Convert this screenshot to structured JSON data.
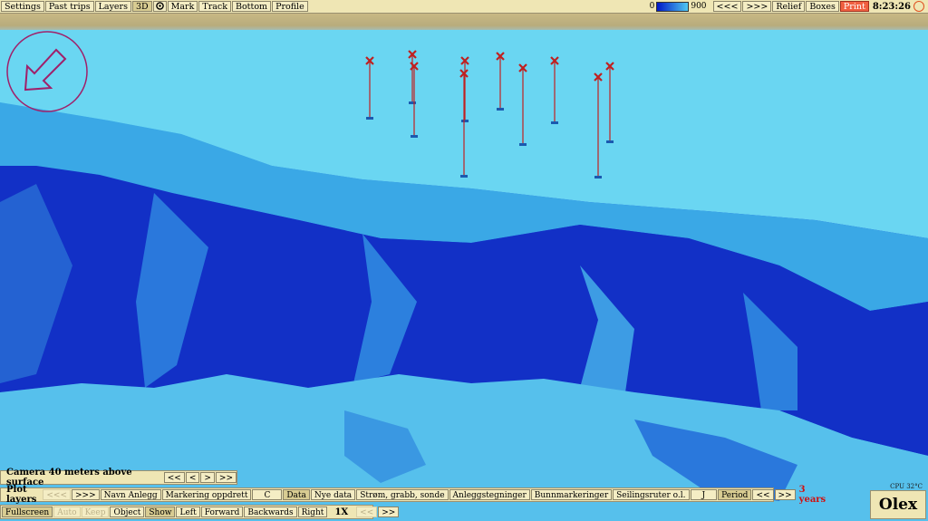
{
  "toolbar": {
    "settings": "Settings",
    "past_trips": "Past trips",
    "layers": "Layers",
    "three_d": "3D",
    "mark": "Mark",
    "track": "Track",
    "bottom": "Bottom",
    "profile": "Profile",
    "scale_min": "0",
    "scale_max": "900",
    "prev": "<<<",
    "next": ">>>",
    "relief": "Relief",
    "boxes": "Boxes",
    "print": "Print",
    "time": "8:23:26"
  },
  "camera": {
    "label": "Camera 40 meters above surface",
    "btn_far_prev": "<<",
    "btn_prev": "<",
    "btn_next": ">",
    "btn_far_next": ">>"
  },
  "plot_layers": {
    "label": "Plot layers",
    "prev": "<<<",
    "next": ">>>",
    "items": [
      "Navn Anlegg",
      "Markering oppdrett",
      "C",
      "Data",
      "Nye data",
      "Strøm, grabb, sonde",
      "Anleggstegninger",
      "Bunnmarkeringer",
      "Seilingsruter o.l.",
      "J"
    ],
    "period_label": "Period",
    "period_prev": "<<",
    "period_next": ">>",
    "period_value": "3 years"
  },
  "view_bar": {
    "fullscreen": "Fullscreen",
    "auto": "Auto",
    "keep": "Keep",
    "object": "Object",
    "show": "Show",
    "left": "Left",
    "forward": "Forward",
    "backwards": "Backwards",
    "right": "Right",
    "zoom": "1X",
    "zoom_prev": "<<",
    "zoom_next": ">>"
  },
  "status": {
    "cpu": "CPU 32°C",
    "logo": "Olex"
  },
  "colors": {
    "toolbar_bg": "#efe6b4",
    "shallow": "#62d4f0",
    "deep": "#0f2cc8",
    "marker": "#c02020",
    "compass": "#a0206a"
  },
  "markers": [
    {
      "label": "x"
    },
    {
      "label": "x"
    },
    {
      "label": "x"
    },
    {
      "label": "x"
    },
    {
      "label": "x"
    },
    {
      "label": "x"
    },
    {
      "label": "x"
    },
    {
      "label": "x"
    },
    {
      "label": "x"
    },
    {
      "label": "x"
    },
    {
      "label": "x"
    }
  ]
}
